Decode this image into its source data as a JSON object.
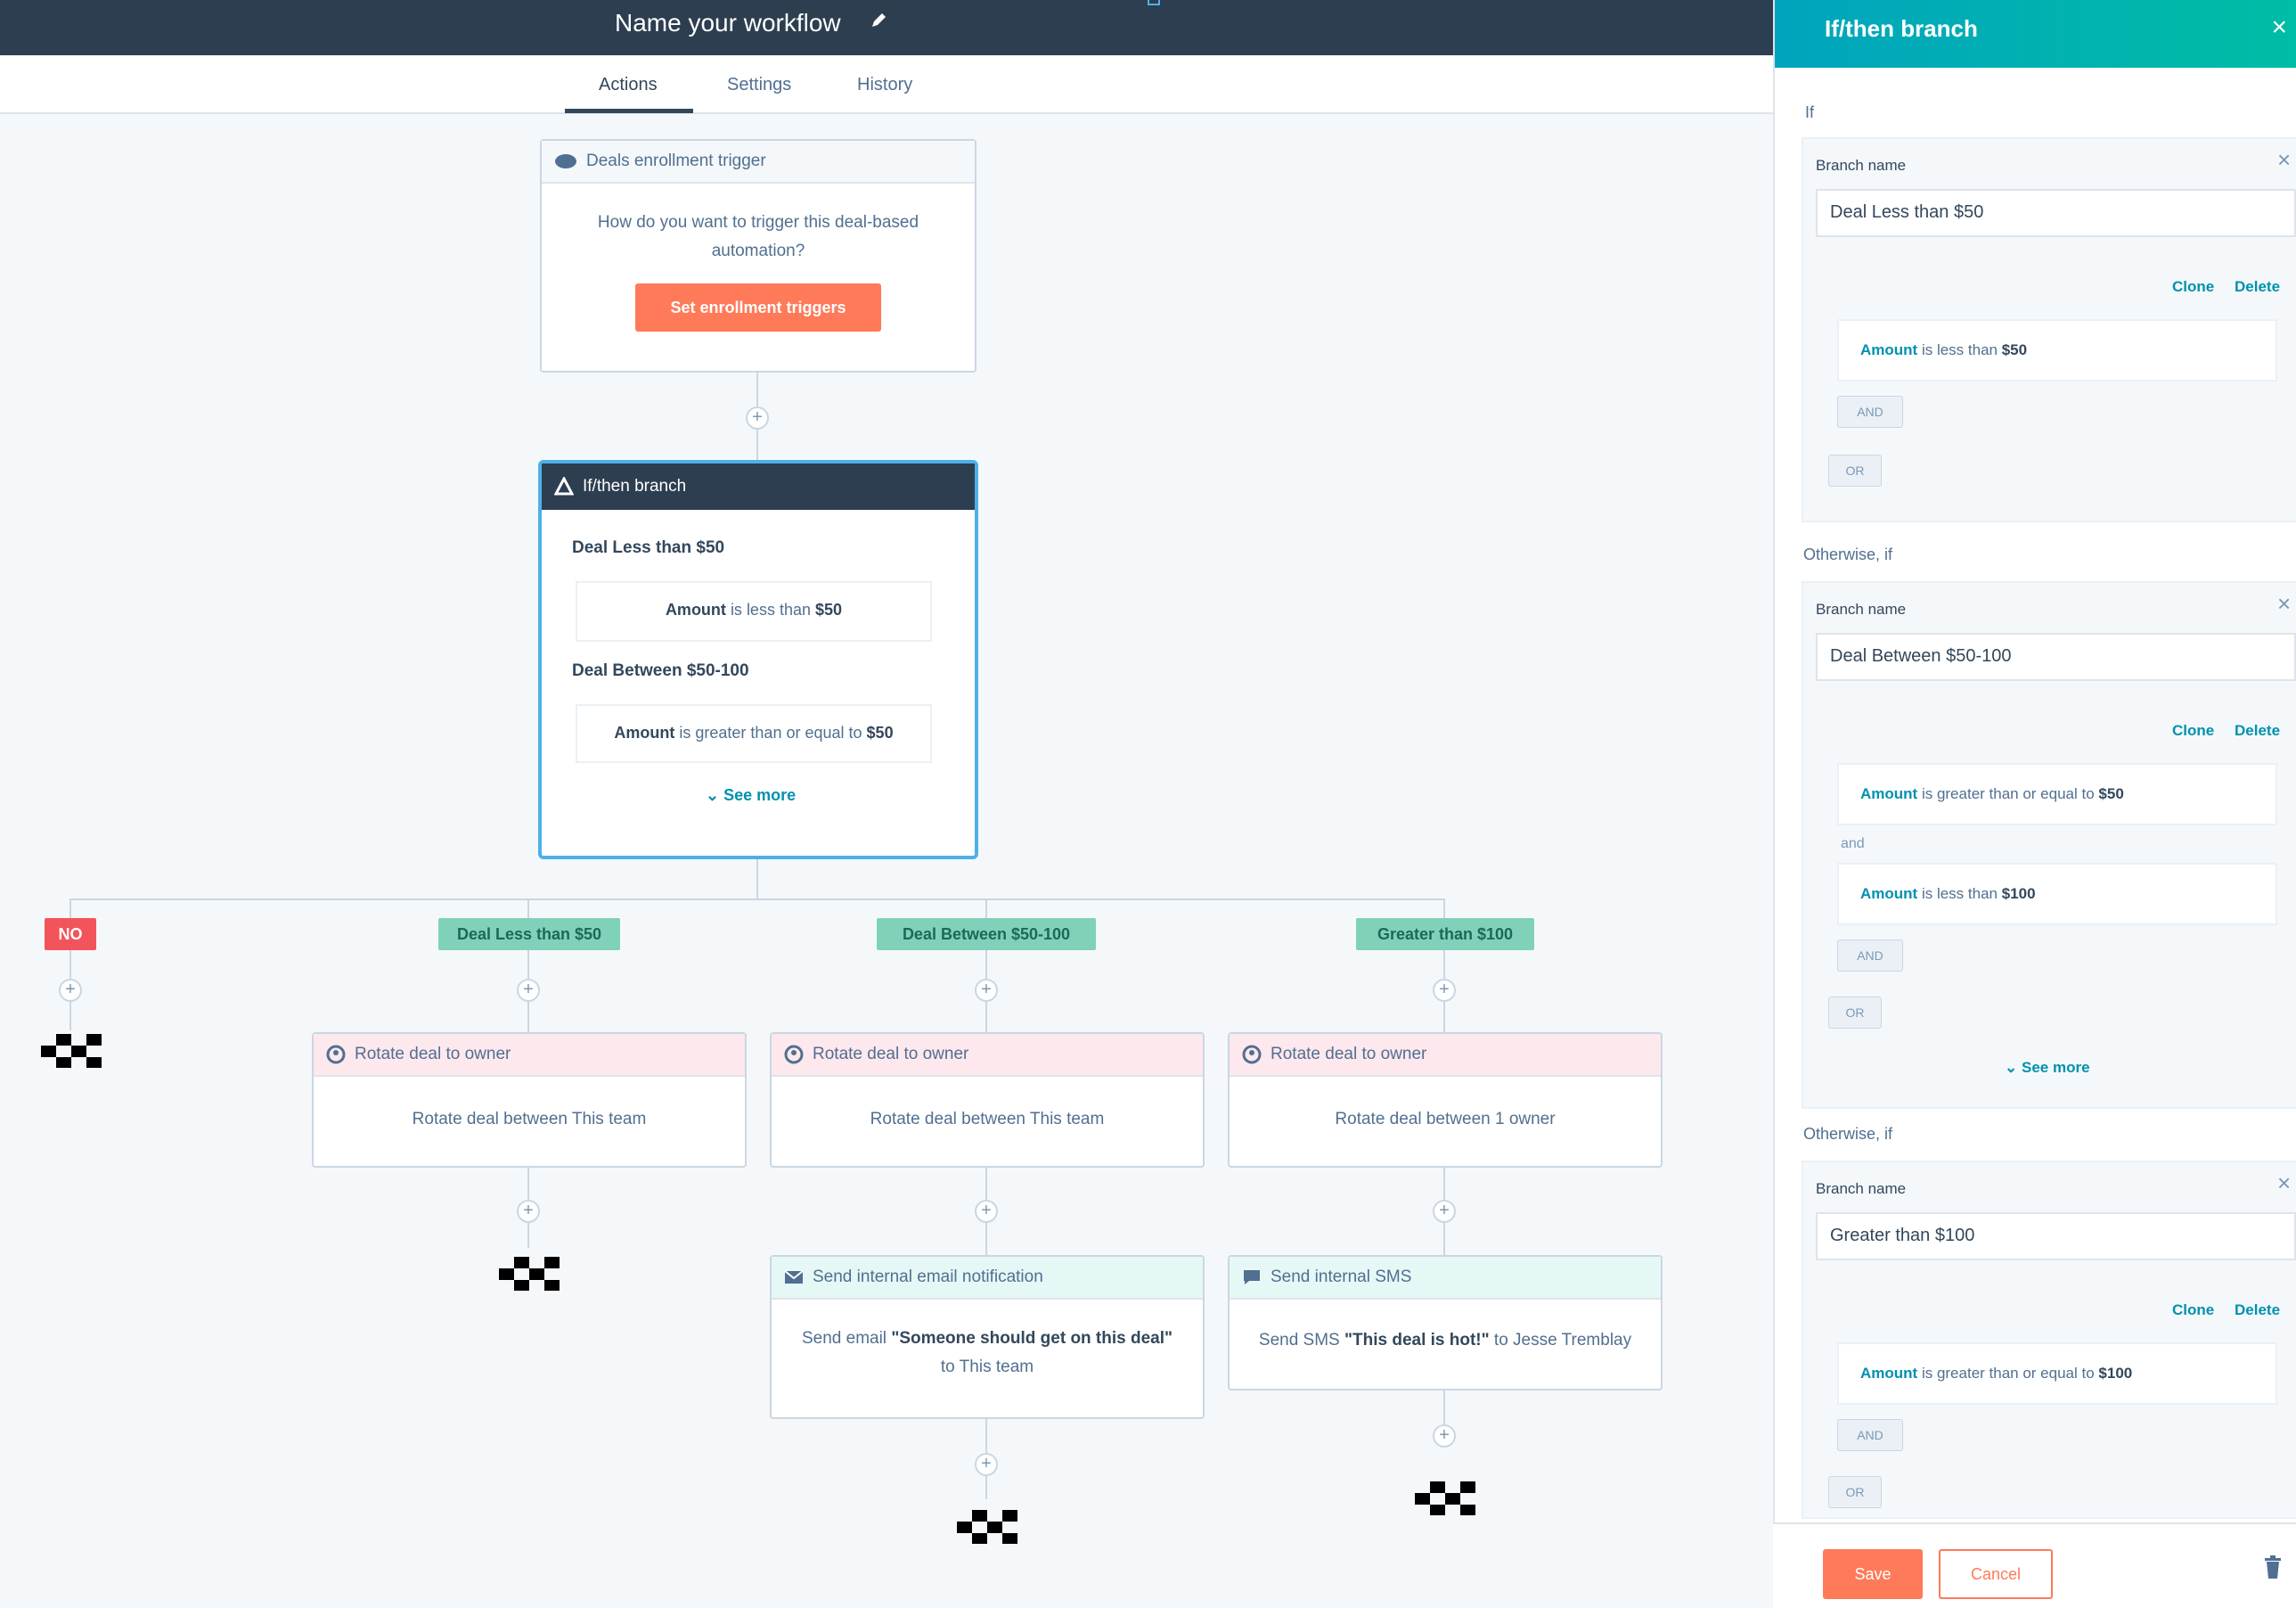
{
  "header": {
    "title": "Name your workflow",
    "tabs": [
      {
        "label": "Actions"
      },
      {
        "label": "Settings"
      },
      {
        "label": "History"
      }
    ]
  },
  "trigger": {
    "title": "Deals enrollment trigger",
    "question": "How do you want to trigger this deal-based automation?",
    "button": "Set enrollment triggers"
  },
  "ifthen": {
    "title": "If/then branch",
    "branches": [
      {
        "name": "Deal Less than $50",
        "prop": "Amount",
        "op": "is less than",
        "val": "$50"
      },
      {
        "name": "Deal Between $50-100",
        "prop": "Amount",
        "op": "is greater than or equal to",
        "val": "$50"
      }
    ],
    "see_more": "See more"
  },
  "tags": {
    "no": "NO",
    "b1": "Deal Less than $50",
    "b2": "Deal Between $50-100",
    "b3": "Greater than $100"
  },
  "actions": {
    "rotate1": {
      "title": "Rotate deal to owner",
      "body": "Rotate deal between This team"
    },
    "rotate2": {
      "title": "Rotate deal to owner",
      "body": "Rotate deal between This team"
    },
    "rotate3": {
      "title": "Rotate deal to owner",
      "body": "Rotate deal between 1 owner"
    },
    "email": {
      "title": "Send internal email notification",
      "body_pre": "Send email ",
      "body_bold": "\"Someone should get on this deal\"",
      "body_post": " to This team"
    },
    "sms": {
      "title": "Send internal SMS",
      "body_pre": "Send SMS ",
      "body_bold": "\"This deal is hot!\"",
      "body_post": " to Jesse Tremblay"
    }
  },
  "panel": {
    "title": "If/then branch",
    "if_label": "If",
    "otherwise_label": "Otherwise, if",
    "branch_name_label": "Branch name",
    "clone": "Clone",
    "delete": "Delete",
    "and_chip": "AND",
    "or_chip": "OR",
    "and_text": "and",
    "see_more": "See more",
    "b1": {
      "name": "Deal Less than $50",
      "c1_prop": "Amount",
      "c1_op": " is less than ",
      "c1_val": "$50"
    },
    "b2": {
      "name": "Deal Between $50-100",
      "c1_prop": "Amount",
      "c1_op": " is greater than or equal to ",
      "c1_val": "$50",
      "c2_prop": "Amount",
      "c2_op": " is less than ",
      "c2_val": "$100"
    },
    "b3": {
      "name": "Greater than $100",
      "c1_prop": "Amount",
      "c1_op": " is greater than or equal to ",
      "c1_val": "$100"
    },
    "save": "Save",
    "cancel": "Cancel"
  }
}
